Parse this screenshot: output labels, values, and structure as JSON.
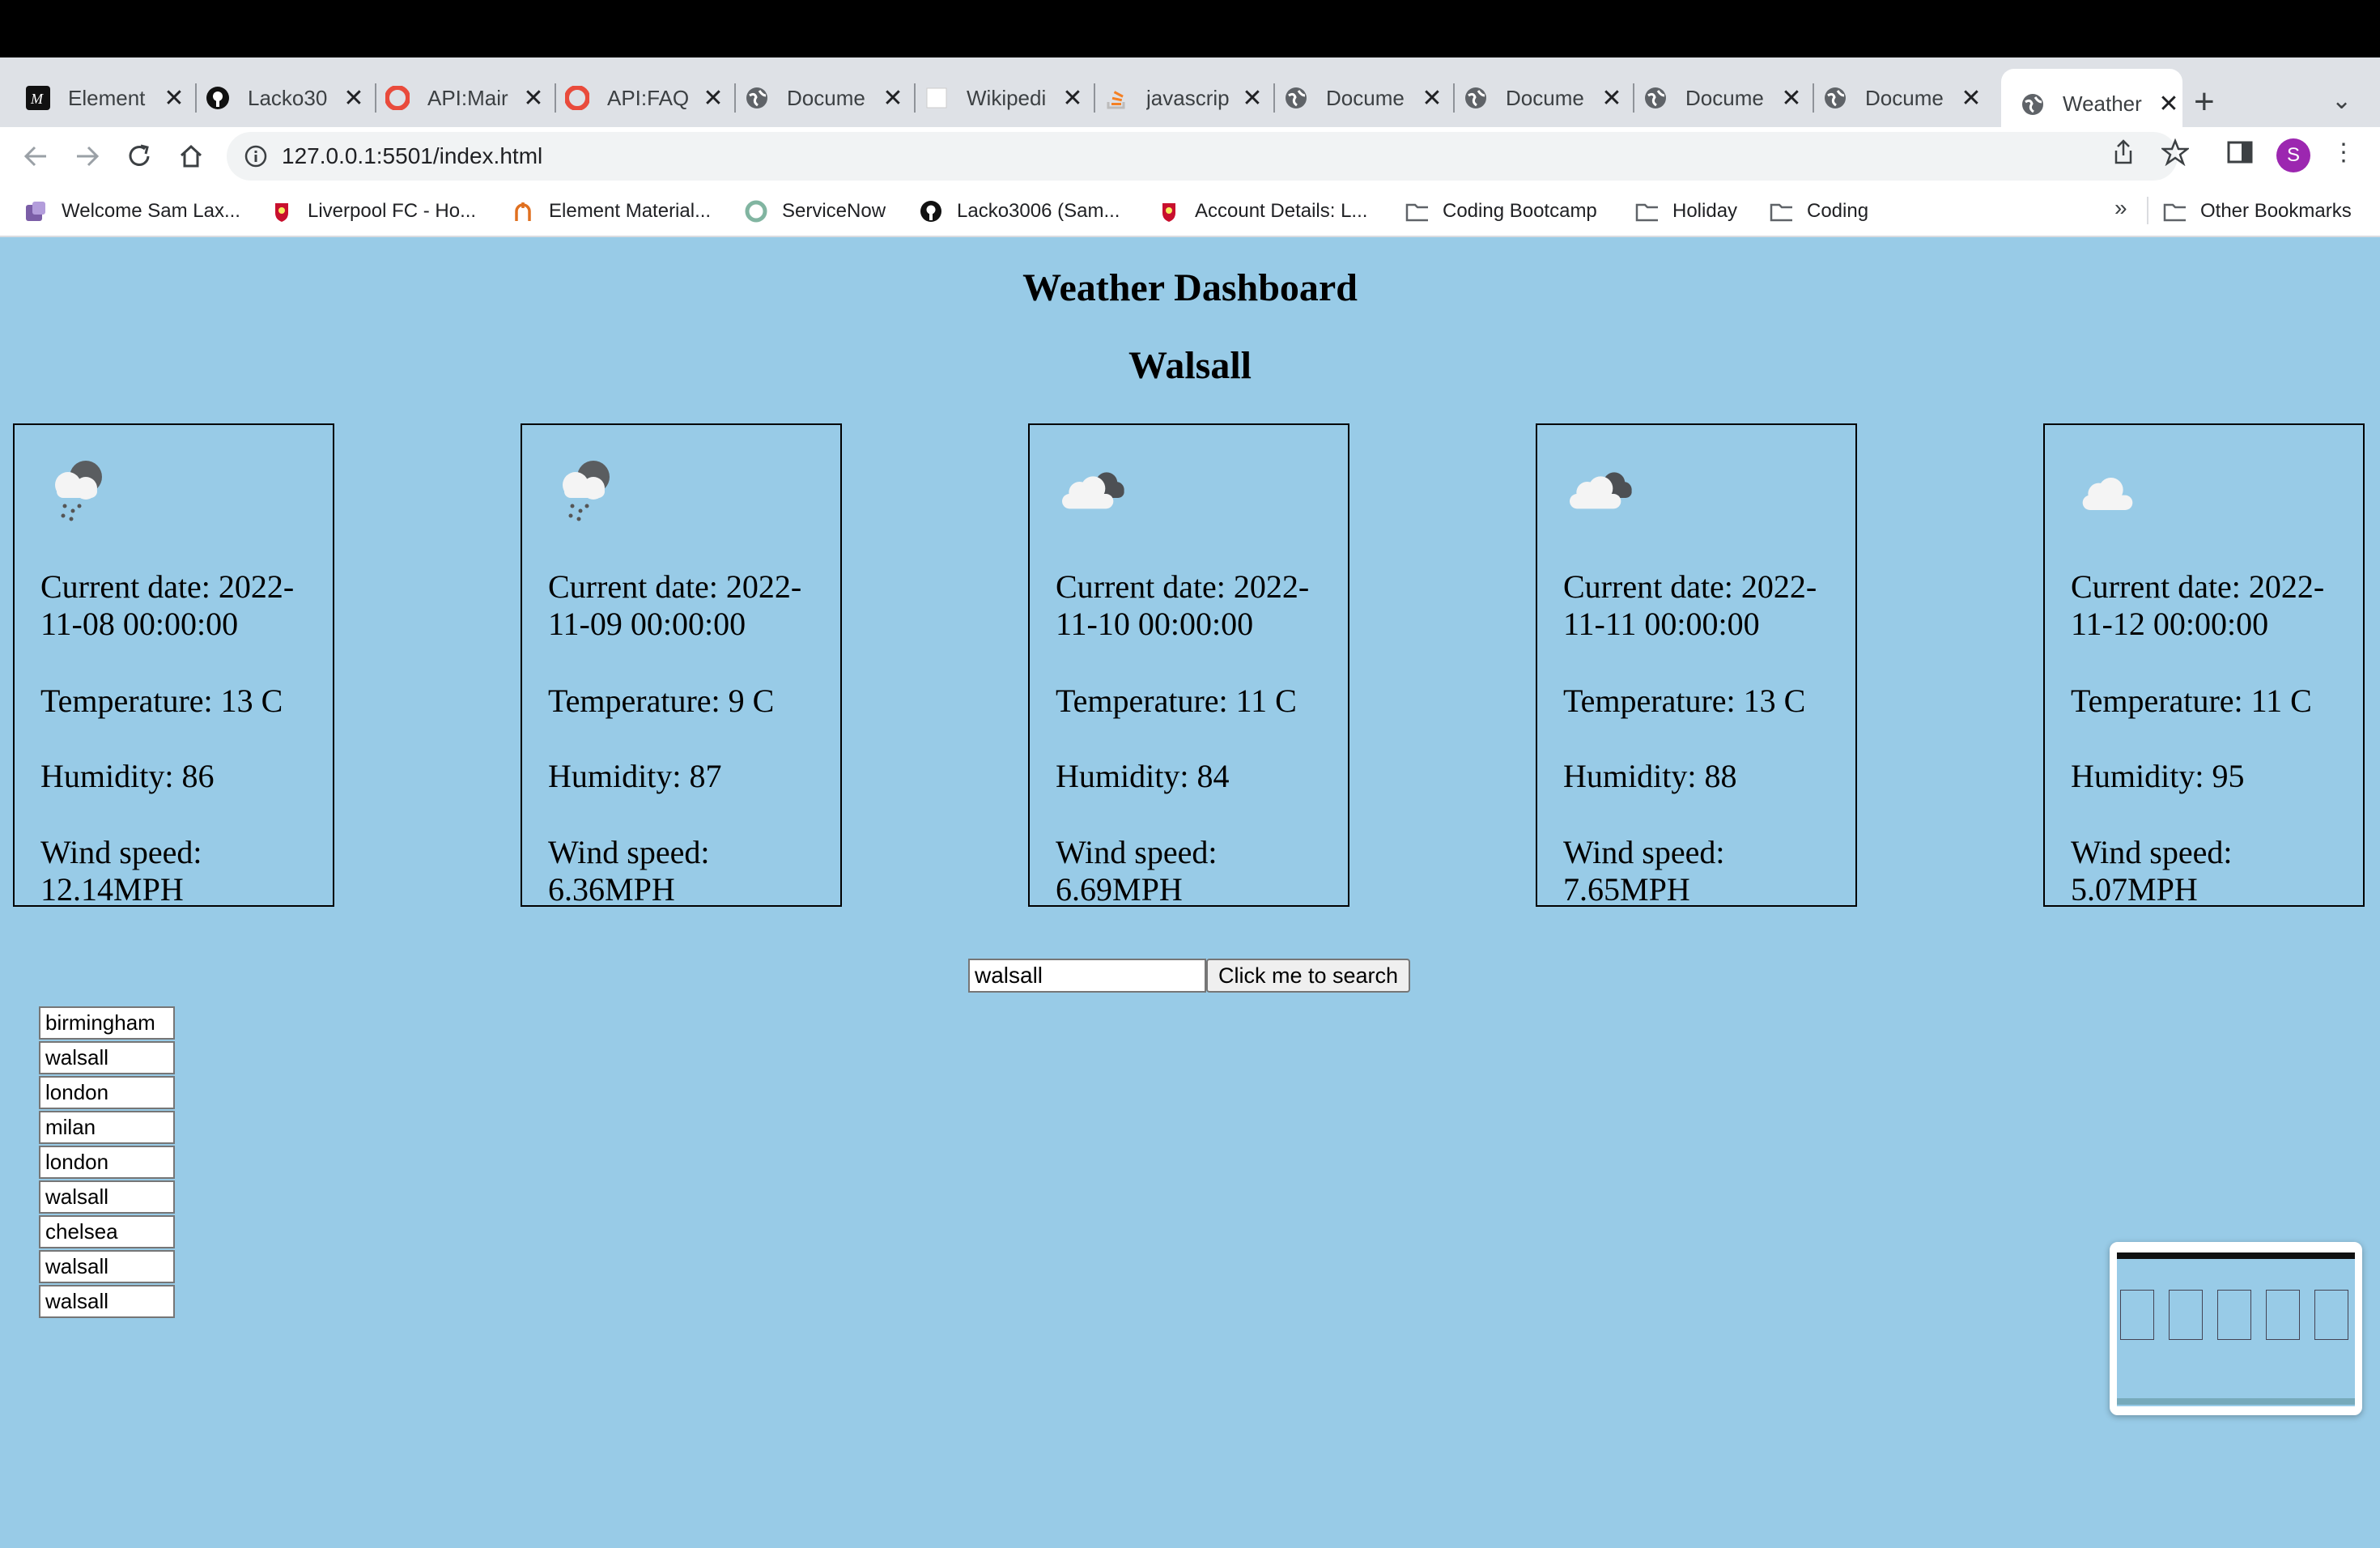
{
  "browser": {
    "tabs": [
      {
        "title": "Element",
        "icon": "element-logo-icon"
      },
      {
        "title": "Lacko30",
        "icon": "github-icon"
      },
      {
        "title": "API:Mair",
        "icon": "openweather-icon"
      },
      {
        "title": "API:FAQ",
        "icon": "openweather-icon"
      },
      {
        "title": "Docume",
        "icon": "globe-icon"
      },
      {
        "title": "Wikipedi",
        "icon": "wikipedia-icon"
      },
      {
        "title": "javascrip",
        "icon": "stackoverflow-icon"
      },
      {
        "title": "Docume",
        "icon": "globe-icon"
      },
      {
        "title": "Docume",
        "icon": "globe-icon"
      },
      {
        "title": "Docume",
        "icon": "globe-icon"
      },
      {
        "title": "Docume",
        "icon": "globe-icon"
      },
      {
        "title": "Weather",
        "icon": "globe-icon",
        "active": true
      }
    ],
    "url": "127.0.0.1:5501/index.html",
    "profile_initial": "S",
    "bookmarks": [
      {
        "label": "Welcome Sam Lax...",
        "icon": "app-icon"
      },
      {
        "label": "Liverpool FC - Ho...",
        "icon": "lfc-crest-icon"
      },
      {
        "label": "Element Material...",
        "icon": "element-material-icon"
      },
      {
        "label": "ServiceNow",
        "icon": "servicenow-icon"
      },
      {
        "label": "Lacko3006 (Sam...",
        "icon": "github-icon"
      },
      {
        "label": "Account Details: L...",
        "icon": "lfc-crest-icon"
      },
      {
        "label": "Coding Bootcamp",
        "icon": "folder-icon"
      },
      {
        "label": "Holiday",
        "icon": "folder-icon"
      },
      {
        "label": "Coding",
        "icon": "folder-icon"
      }
    ],
    "overflow_label": "»",
    "other_bookmarks": "Other Bookmarks"
  },
  "page": {
    "title": "Weather Dashboard",
    "city": "Walsall",
    "forecast": [
      {
        "icon": "rain-snow-icon",
        "date": "Current date: 2022-11-08 00:00:00",
        "temperature": "Temperature: 13 C",
        "humidity": "Humidity: 86",
        "wind": "Wind speed: 12.14MPH"
      },
      {
        "icon": "rain-snow-icon",
        "date": "Current date: 2022-11-09 00:00:00",
        "temperature": "Temperature: 9 C",
        "humidity": "Humidity: 87",
        "wind": "Wind speed: 6.36MPH"
      },
      {
        "icon": "broken-clouds-icon",
        "date": "Current date: 2022-11-10 00:00:00",
        "temperature": "Temperature: 11 C",
        "humidity": "Humidity: 84",
        "wind": "Wind speed: 6.69MPH"
      },
      {
        "icon": "broken-clouds-icon",
        "date": "Current date: 2022-11-11 00:00:00",
        "temperature": "Temperature: 13 C",
        "humidity": "Humidity: 88",
        "wind": "Wind speed: 7.65MPH"
      },
      {
        "icon": "cloud-icon",
        "date": "Current date: 2022-11-12 00:00:00",
        "temperature": "Temperature: 11 C",
        "humidity": "Humidity: 95",
        "wind": "Wind speed: 5.07MPH"
      }
    ],
    "search": {
      "value": "walsall",
      "button_label": "Click me to search"
    },
    "history": [
      "birmingham",
      "walsall",
      "london",
      "milan",
      "london",
      "walsall",
      "chelsea",
      "walsall",
      "walsall"
    ]
  },
  "colors": {
    "page_background": "#98cbe7",
    "tab_strip": "#dee1e6",
    "profile": "#9c27b0"
  }
}
